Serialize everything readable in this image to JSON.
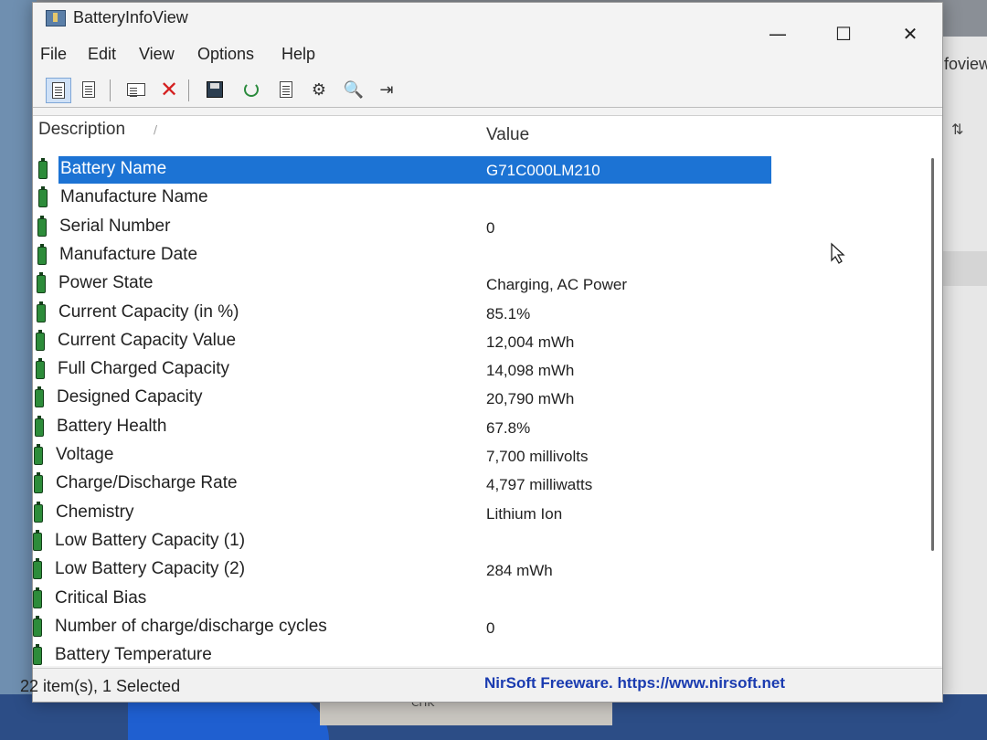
{
  "window": {
    "title": "BatteryInfoView",
    "controls": {
      "minimize": "—",
      "maximize": "☐",
      "close": "✕"
    }
  },
  "menu": [
    "File",
    "Edit",
    "View",
    "Options",
    "Help"
  ],
  "toolbar": {
    "icons": [
      "properties-icon",
      "html-report-icon",
      "copy-icon",
      "delete-icon",
      "save-icon",
      "refresh-icon",
      "copy-selected-icon",
      "options-icon",
      "find-icon",
      "exit-icon"
    ]
  },
  "columns": {
    "description": "Description",
    "value": "Value"
  },
  "rows": [
    {
      "description": "Battery Name",
      "value": "G71C000LM210",
      "selected": true
    },
    {
      "description": "Manufacture Name",
      "value": ""
    },
    {
      "description": "Serial Number",
      "value": "0"
    },
    {
      "description": "Manufacture Date",
      "value": ""
    },
    {
      "description": "Power State",
      "value": "Charging, AC Power"
    },
    {
      "description": "Current Capacity (in %)",
      "value": "85.1%"
    },
    {
      "description": "Current Capacity Value",
      "value": "12,004 mWh"
    },
    {
      "description": "Full Charged Capacity",
      "value": "14,098 mWh"
    },
    {
      "description": "Designed Capacity",
      "value": "20,790 mWh"
    },
    {
      "description": "Battery Health",
      "value": "67.8%"
    },
    {
      "description": "Voltage",
      "value": "7,700 millivolts"
    },
    {
      "description": "Charge/Discharge Rate",
      "value": "4,797 milliwatts"
    },
    {
      "description": "Chemistry",
      "value": "Lithium Ion"
    },
    {
      "description": "Low Battery Capacity (1)",
      "value": ""
    },
    {
      "description": "Low Battery Capacity (2)",
      "value": "284 mWh"
    },
    {
      "description": "Critical Bias",
      "value": ""
    },
    {
      "description": "Number of charge/discharge cycles",
      "value": "0"
    },
    {
      "description": "Battery Temperature",
      "value": ""
    }
  ],
  "status": {
    "items": "22 item(s), 1 Selected",
    "link": "NirSoft Freeware. https://www.nirsoft.net"
  },
  "background": {
    "right_app_text": "foview",
    "taskbar_text": "CHK"
  },
  "colors": {
    "selection": "#1c73d4",
    "battery_icon": "#2d8c3a",
    "link": "#1a3bb0"
  }
}
